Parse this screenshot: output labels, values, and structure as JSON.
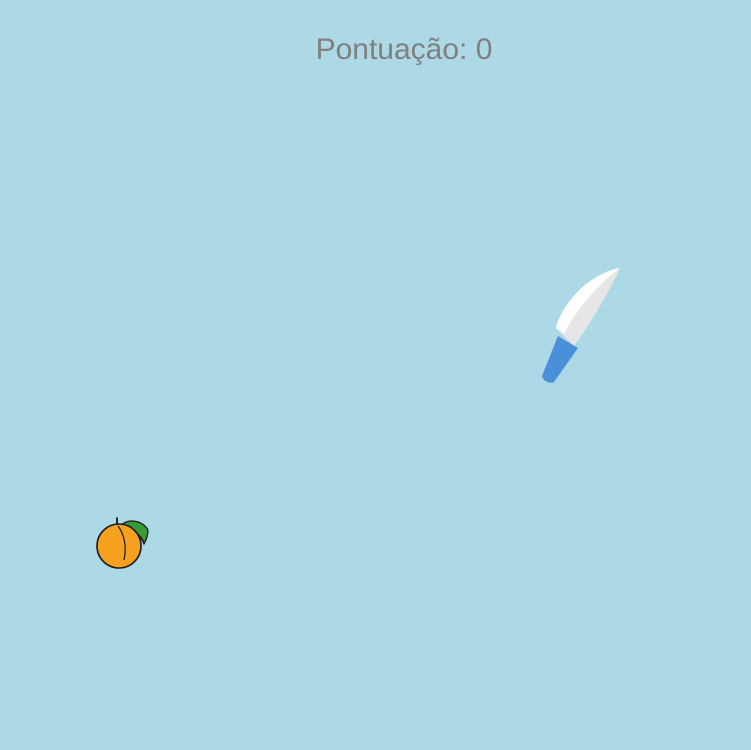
{
  "hud": {
    "score_text": "Pontuação: 0"
  },
  "colors": {
    "background": "#add8e6",
    "score_text": "#808080",
    "knife_blade": "#e6e6e6",
    "knife_blade_edge": "#ffffff",
    "knife_handle": "#4a90d9",
    "fruit_body": "#f6a020",
    "fruit_outline": "#1a1a1a",
    "fruit_leaf": "#3a9a3a"
  },
  "icons": {
    "knife": "knife-icon",
    "fruit": "orange-icon"
  }
}
